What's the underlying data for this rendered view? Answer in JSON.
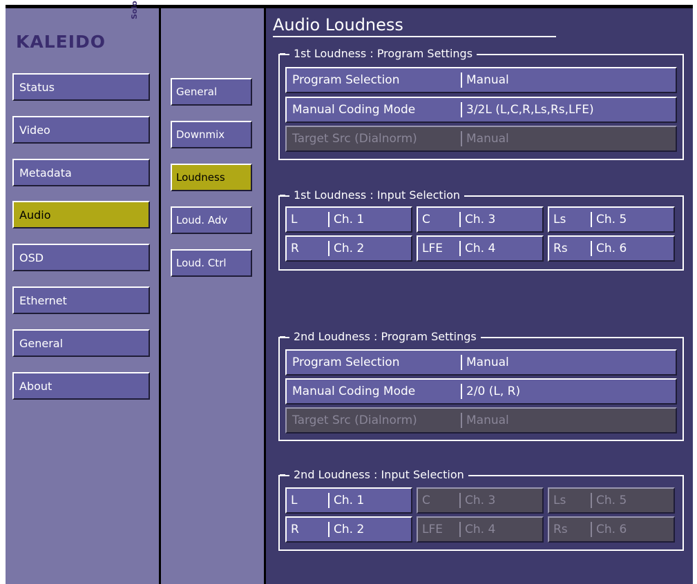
{
  "logo": {
    "main": "KALEIDO",
    "sub": "Solo"
  },
  "nav": [
    "Status",
    "Video",
    "Metadata",
    "Audio",
    "OSD",
    "Ethernet",
    "General",
    "About"
  ],
  "subnav": [
    "General",
    "Downmix",
    "Loudness",
    "Loud. Adv",
    "Loud. Ctrl"
  ],
  "page_title": "Audio Loudness",
  "groups": {
    "prog1": {
      "label": "1st Loudness : Program Settings",
      "rows": [
        {
          "key": "Program Selection",
          "value": "Manual"
        },
        {
          "key": "Manual Coding Mode",
          "value": "3/2L (L,C,R,Ls,Rs,LFE)"
        },
        {
          "key": "Target Src (Dialnorm)",
          "value": "Manual"
        }
      ]
    },
    "input1": {
      "label": "1st Loudness : Input Selection",
      "cells": [
        {
          "key": "L",
          "value": "Ch. 1"
        },
        {
          "key": "C",
          "value": "Ch. 3"
        },
        {
          "key": "Ls",
          "value": "Ch. 5"
        },
        {
          "key": "R",
          "value": "Ch. 2"
        },
        {
          "key": "LFE",
          "value": "Ch. 4"
        },
        {
          "key": "Rs",
          "value": "Ch. 6"
        }
      ]
    },
    "prog2": {
      "label": "2nd Loudness : Program Settings",
      "rows": [
        {
          "key": "Program Selection",
          "value": "Manual"
        },
        {
          "key": "Manual Coding Mode",
          "value": "2/0 (L, R)"
        },
        {
          "key": "Target Src (Dialnorm)",
          "value": "Manual"
        }
      ]
    },
    "input2": {
      "label": "2nd Loudness : Input Selection",
      "cells": [
        {
          "key": "L",
          "value": "Ch. 1"
        },
        {
          "key": "C",
          "value": "Ch. 3"
        },
        {
          "key": "Ls",
          "value": "Ch. 5"
        },
        {
          "key": "R",
          "value": "Ch. 2"
        },
        {
          "key": "LFE",
          "value": "Ch. 4"
        },
        {
          "key": "Rs",
          "value": "Ch. 6"
        }
      ]
    }
  },
  "colors": {
    "panel_bg": "#3e3a6c",
    "sidebar_bg": "#7a76a6",
    "button_bg": "#625ea0",
    "active_bg": "#b0a816",
    "disabled_bg": "#4e4a58"
  }
}
